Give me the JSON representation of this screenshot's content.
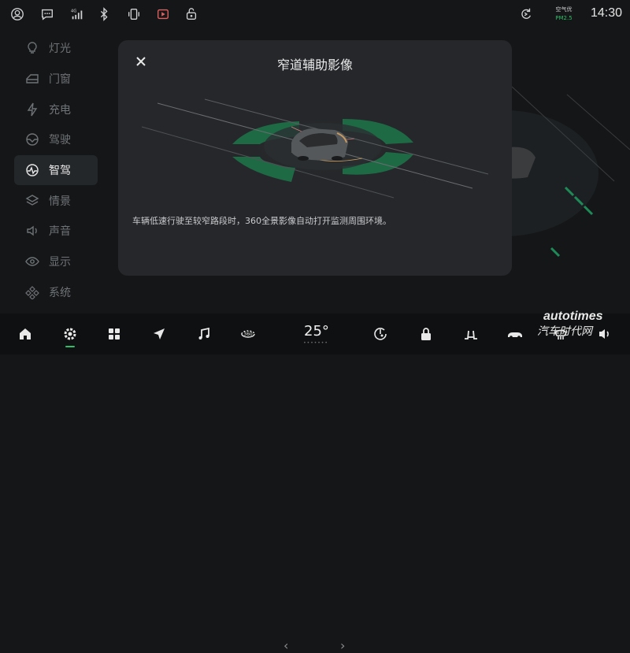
{
  "status_bar": {
    "icons": [
      "account-icon",
      "message-icon",
      "signal-4g-icon",
      "bluetooth-icon",
      "phone-vibrate-icon",
      "dashcam-record-icon",
      "car-lock-icon",
      "sync-icon"
    ],
    "signal_label": "4G",
    "air_quality": {
      "label": "空气优",
      "value": "PM2.5"
    },
    "time": "14:30"
  },
  "sidebar": {
    "items": [
      {
        "label": "灯光",
        "icon": "bulb-icon"
      },
      {
        "label": "门窗",
        "icon": "door-icon"
      },
      {
        "label": "充电",
        "icon": "bolt-icon"
      },
      {
        "label": "驾驶",
        "icon": "steering-icon"
      },
      {
        "label": "智驾",
        "icon": "smart-drive-icon",
        "active": true
      },
      {
        "label": "情景",
        "icon": "layers-icon"
      },
      {
        "label": "声音",
        "icon": "speaker-icon"
      },
      {
        "label": "显示",
        "icon": "eye-icon"
      },
      {
        "label": "系统",
        "icon": "diamond-grid-icon"
      }
    ]
  },
  "modal": {
    "title": "窄道辅助影像",
    "description": "车辆低速行驶至较窄路段时，360全景影像自动打开监测周围环境。"
  },
  "dock": {
    "items": [
      "home-icon",
      "settings-icon",
      "apps-icon",
      "navigation-icon",
      "music-icon",
      "360-view-icon",
      "fan-icon",
      "lock-icon",
      "seat-icon",
      "car-icon",
      "defrost-icon",
      "volume-icon"
    ],
    "view_360_label": "360",
    "temperature": "25°",
    "temp_dots": "•••••••"
  },
  "watermark": {
    "line1": "autotimes",
    "line2": "汽车时代网"
  },
  "colors": {
    "accent": "#2fbf6a",
    "panel": "#25272a",
    "background": "#151617"
  }
}
